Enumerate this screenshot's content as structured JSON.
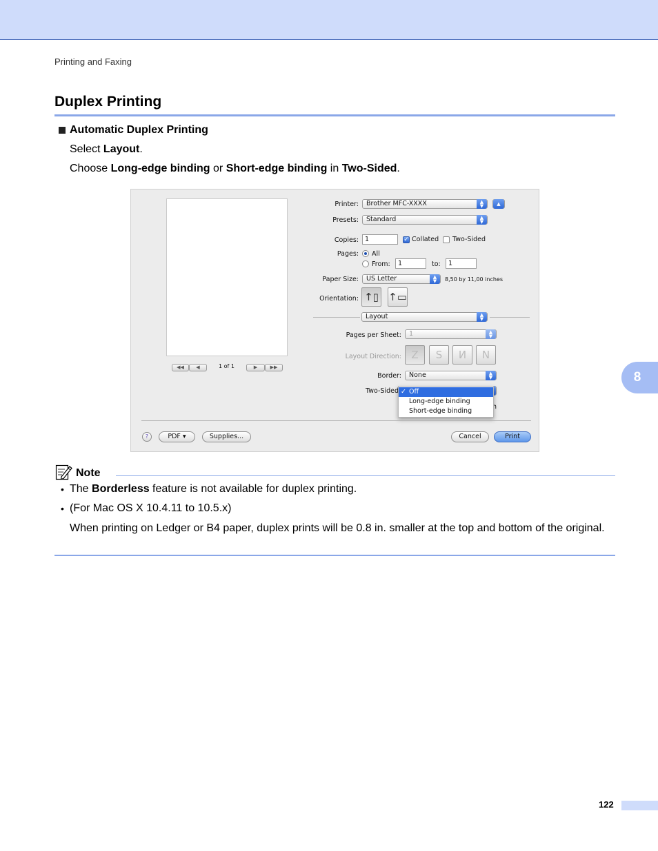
{
  "header": {
    "breadcrumb": "Printing and Faxing",
    "chapter_number": "8"
  },
  "section": {
    "title": "Duplex Printing",
    "subsection": "Automatic Duplex Printing",
    "step1": {
      "pre": "Select ",
      "b1": "Layout",
      "post": "."
    },
    "step2": {
      "pre": "Choose ",
      "b1": "Long-edge binding",
      "mid1": " or ",
      "b2": "Short-edge binding",
      "mid2": " in ",
      "b3": "Two-Sided",
      "post": "."
    }
  },
  "dialog": {
    "preview_page": "1 of 1",
    "printer": {
      "label": "Printer:",
      "value": "Brother MFC-XXXX"
    },
    "presets": {
      "label": "Presets:",
      "value": "Standard"
    },
    "copies": {
      "label": "Copies:",
      "value": "1",
      "collated": "Collated",
      "two_sided": "Two-Sided"
    },
    "pages": {
      "label": "Pages:",
      "all": "All",
      "from": "From:",
      "from_value": "1",
      "to": "to:",
      "to_value": "1"
    },
    "paper_size": {
      "label": "Paper Size:",
      "value": "US Letter",
      "dimensions": "8,50 by 11,00 inches"
    },
    "orientation": {
      "label": "Orientation:"
    },
    "panel": {
      "value": "Layout"
    },
    "pages_per_sheet": {
      "label": "Pages per Sheet:",
      "value": "1"
    },
    "layout_direction": {
      "label": "Layout Direction:"
    },
    "border": {
      "label": "Border:",
      "value": "None"
    },
    "two_sided": {
      "label": "Two-Sided",
      "options": [
        "Off",
        "Long-edge binding",
        "Short-edge binding"
      ],
      "selected": "Off",
      "tick": "✓",
      "clipped_char": "n"
    },
    "buttons": {
      "help": "?",
      "pdf": "PDF ▾",
      "supplies": "Supplies...",
      "cancel": "Cancel",
      "print": "Print"
    }
  },
  "note": {
    "title": "Note",
    "bullets": [
      {
        "pre": "The ",
        "bold": "Borderless",
        "post": " feature is not available for duplex printing."
      },
      {
        "text": "(For Mac OS X 10.4.11 to 10.5.x)"
      }
    ],
    "continuation": "When printing on Ledger or B4 paper, duplex prints will be 0.8 in. smaller at the top and bottom of the original."
  },
  "footer": {
    "page_number": "122"
  },
  "colors": {
    "accent": "#8aa7e8",
    "header_band": "#cfdcfb",
    "chapter_tab": "#a5bdf4"
  }
}
